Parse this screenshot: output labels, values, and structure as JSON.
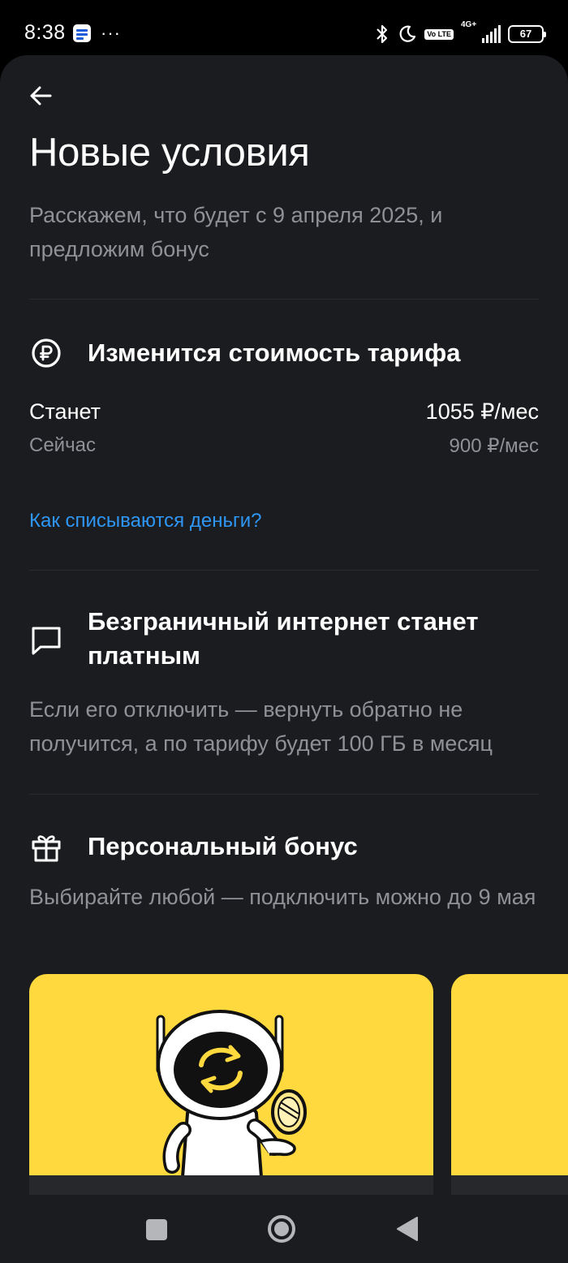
{
  "status_bar": {
    "time": "8:38",
    "more": "···",
    "volte": "Vo LTE",
    "network": "4G+",
    "battery": "67",
    "icons": [
      "notification-app-icon",
      "bluetooth-icon",
      "moon-icon",
      "volte-icon",
      "signal-icon",
      "battery-icon"
    ]
  },
  "header": {
    "back_icon": "arrow-left-icon",
    "title": "Новые условия",
    "subtitle": "Расскажем, что будет с 9 апреля 2025, и предложим бонус"
  },
  "price_section": {
    "icon": "ruble-icon",
    "title": "Изменится стоимость тарифа",
    "new_label": "Станет",
    "new_value": "1055 ₽/мес",
    "current_label": "Сейчас",
    "current_value": "900 ₽/мес",
    "link": "Как списываются деньги?"
  },
  "internet_section": {
    "icon": "message-square-icon",
    "title": "Безграничный интернет станет платным",
    "body": "Если его отключить — вернуть обратно не получится, а по тарифу будет 100 ГБ в месяц"
  },
  "bonus_section": {
    "icon": "gift-icon",
    "title": "Персональный бонус",
    "body": "Выбирайте любой — подключить можно до 9 мая",
    "cards": [
      {
        "illustration": "robot-with-coin-illustration"
      },
      {
        "illustration": ""
      }
    ]
  },
  "colors": {
    "background": "#1b1c20",
    "muted_text": "#8f9197",
    "link": "#2e97f5",
    "card": "#ffd93d"
  },
  "nav_bar": {
    "icons": [
      "recent-apps-icon",
      "home-icon",
      "back-triangle-icon"
    ]
  }
}
